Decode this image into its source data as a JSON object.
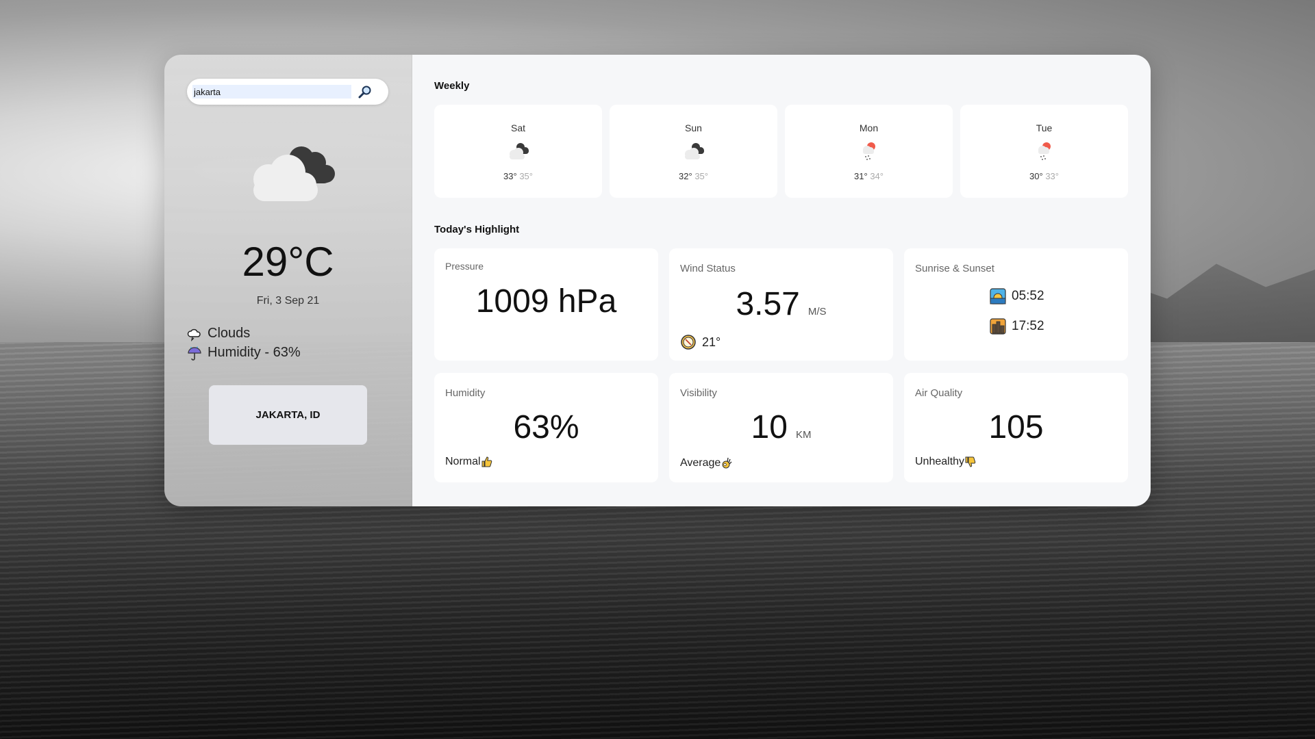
{
  "search": {
    "value": "jakarta"
  },
  "current": {
    "temp": "29°C",
    "date": "Fri, 3 Sep 21",
    "condition": "Clouds",
    "humidity_text": "Humidity - 63%",
    "city": "JAKARTA, ID",
    "icon": "broken-clouds-icon"
  },
  "weekly": {
    "title": "Weekly",
    "days": [
      {
        "name": "Sat",
        "min": "33°",
        "max": "35°",
        "icon": "broken-clouds-icon"
      },
      {
        "name": "Sun",
        "min": "32°",
        "max": "35°",
        "icon": "broken-clouds-icon"
      },
      {
        "name": "Mon",
        "min": "31°",
        "max": "34°",
        "icon": "light-rain-icon"
      },
      {
        "name": "Tue",
        "min": "30°",
        "max": "33°",
        "icon": "light-rain-icon"
      }
    ]
  },
  "highlight": {
    "title": "Today's Highlight",
    "pressure": {
      "label": "Pressure",
      "value": "1009 hPa"
    },
    "wind": {
      "label": "Wind Status",
      "value": "3.57",
      "unit": "M/S",
      "direction": "21°"
    },
    "sun": {
      "label": "Sunrise & Sunset",
      "sunrise": "05:52",
      "sunset": "17:52"
    },
    "humidity": {
      "label": "Humidity",
      "value": "63%",
      "note": "Normal"
    },
    "visibility": {
      "label": "Visibility",
      "value": "10",
      "unit": "KM",
      "note": "Average"
    },
    "air": {
      "label": "Air Quality",
      "value": "105",
      "note": "Unhealthy"
    }
  },
  "colors": {
    "panel_right": "#f6f7f9",
    "card": "#ffffff",
    "city_button": "#e6e7ec"
  }
}
